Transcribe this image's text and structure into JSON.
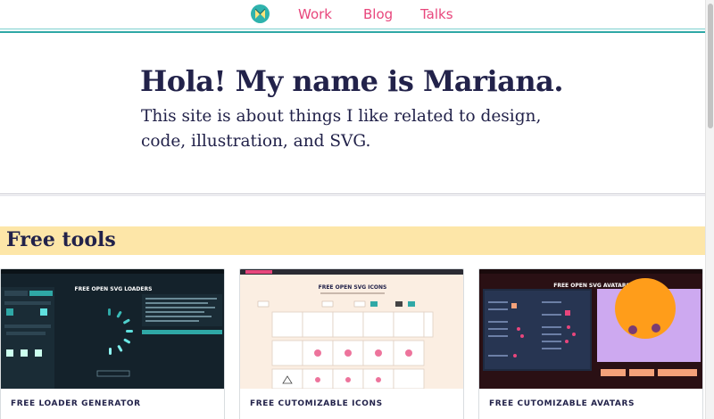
{
  "nav": {
    "logo_icon": "mariana-logo-icon",
    "links": [
      "Work",
      "Blog",
      "Talks"
    ]
  },
  "hero": {
    "title": "Hola! My name is Mariana.",
    "text": "This site is about things I like related to design, code, illustration, and SVG."
  },
  "section": {
    "title": "Free tools"
  },
  "cards": [
    {
      "label": "FREE LOADER GENERATOR",
      "thumb_title": "FREE OPEN SVG LOADERS",
      "thumb_title_accent": "LOADERS"
    },
    {
      "label": "FREE CUTOMIZABLE ICONS",
      "thumb_title": "FREE OPEN SVG ICONS",
      "thumb_title_accent": "ICONS"
    },
    {
      "label": "FREE CUTOMIZABLE AVATARS",
      "thumb_title": "FREE OPEN SVG AVATARS",
      "thumb_title_accent": "AVATARS"
    }
  ],
  "colors": {
    "accent_pink": "#e8467c",
    "teal": "#2fa8a6",
    "navy": "#22224a",
    "highlight_yellow": "#fde6a8"
  }
}
